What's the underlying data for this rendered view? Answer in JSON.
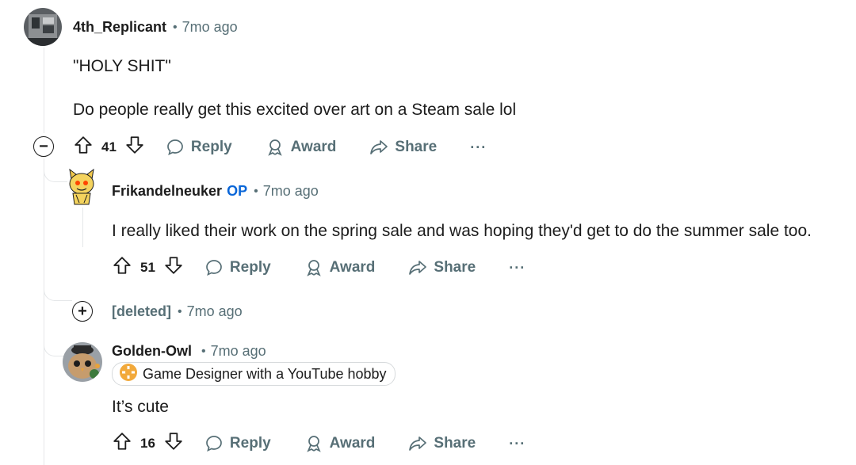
{
  "comments": [
    {
      "author": "4th_Replicant",
      "time": "7mo ago",
      "body_lines": [
        "\"HOLY SHIT\"",
        "Do people really get this excited over art on a Steam sale lol"
      ],
      "votes": "41",
      "toggle": "−"
    },
    {
      "author": "Frikandelneuker",
      "op_label": "OP",
      "time": "7mo ago",
      "body_lines": [
        "I really liked their work on the spring sale and was hoping they'd get to do the summer sale too."
      ],
      "votes": "51"
    },
    {
      "author": "[deleted]",
      "time": "7mo ago",
      "toggle": "+"
    },
    {
      "author": "Golden-Owl",
      "time": "7mo ago",
      "flair": "Game Designer with a YouTube hobby",
      "body_lines": [
        "It’s cute"
      ],
      "votes": "16"
    }
  ],
  "actions": {
    "reply": "Reply",
    "award": "Award",
    "share": "Share",
    "more": "···"
  },
  "separator": "•",
  "colors": {
    "meta_gray": "#576f76",
    "op_blue": "#0a66d8",
    "thread_line": "#e5e7e9"
  }
}
